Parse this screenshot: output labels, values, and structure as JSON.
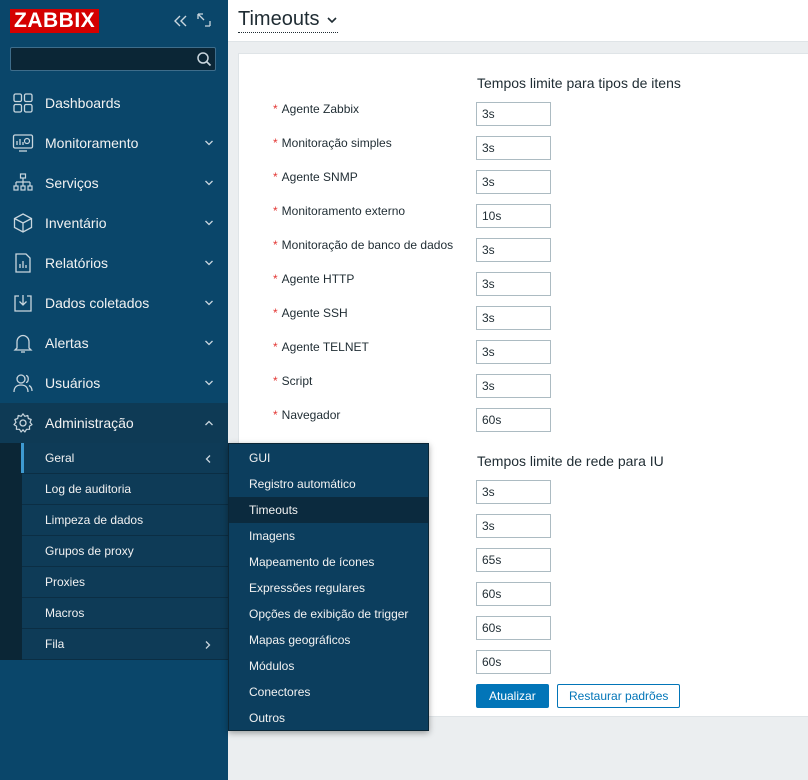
{
  "brand": {
    "logo_text": "ZABBIX",
    "accent": "#d40000",
    "sidebar_bg": "#0a466a"
  },
  "search": {
    "placeholder": "",
    "value": ""
  },
  "nav": {
    "items": [
      {
        "label": "Dashboards",
        "icon": "dashboards-icon"
      },
      {
        "label": "Monitoramento",
        "icon": "monitoring-icon"
      },
      {
        "label": "Serviços",
        "icon": "services-icon"
      },
      {
        "label": "Inventário",
        "icon": "inventory-icon"
      },
      {
        "label": "Relatórios",
        "icon": "reports-icon"
      },
      {
        "label": "Dados coletados",
        "icon": "data-collection-icon"
      },
      {
        "label": "Alertas",
        "icon": "alerts-icon"
      },
      {
        "label": "Usuários",
        "icon": "users-icon"
      },
      {
        "label": "Administração",
        "icon": "administration-icon"
      }
    ],
    "admin_sub": [
      {
        "label": "Geral"
      },
      {
        "label": "Log de auditoria"
      },
      {
        "label": "Limpeza de dados"
      },
      {
        "label": "Grupos de proxy"
      },
      {
        "label": "Proxies"
      },
      {
        "label": "Macros"
      },
      {
        "label": "Fila"
      }
    ]
  },
  "popup": {
    "items": [
      "GUI",
      "Registro automático",
      "Timeouts",
      "Imagens",
      "Mapeamento de ícones",
      "Expressões regulares",
      "Opções de exibição de trigger",
      "Mapas geográficos",
      "Módulos",
      "Conectores",
      "Outros"
    ]
  },
  "header": {
    "title": "Timeouts"
  },
  "form": {
    "section1_title": "Tempos limite para tipos de itens",
    "section2_title": "Tempos limite de rede para IU",
    "item_timeouts": [
      {
        "label": "Agente Zabbix",
        "value": "3s"
      },
      {
        "label": "Monitoração simples",
        "value": "3s"
      },
      {
        "label": "Agente SNMP",
        "value": "3s"
      },
      {
        "label": "Monitoramento externo",
        "value": "10s"
      },
      {
        "label": "Monitoração de banco de dados",
        "value": "3s"
      },
      {
        "label": "Agente HTTP",
        "value": "3s"
      },
      {
        "label": "Agente SSH",
        "value": "3s"
      },
      {
        "label": "Agente TELNET",
        "value": "3s"
      },
      {
        "label": "Script",
        "value": "3s"
      },
      {
        "label": "Navegador",
        "value": "60s"
      }
    ],
    "network_timeouts": [
      {
        "value": "3s"
      },
      {
        "value": "3s"
      },
      {
        "value": "65s"
      },
      {
        "value": "60s"
      },
      {
        "value": "60s"
      },
      {
        "value": "60s"
      }
    ],
    "required_marker": "*",
    "update_label": "Atualizar",
    "reset_label": "Restaurar padrões"
  }
}
